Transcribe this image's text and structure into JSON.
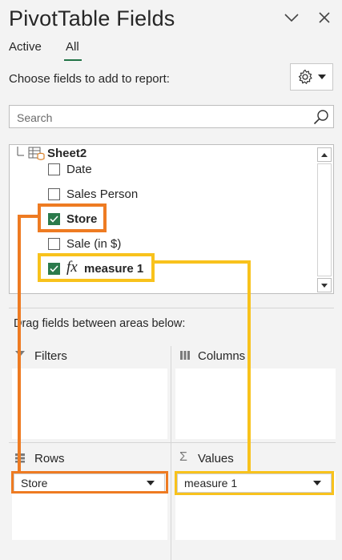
{
  "panel": {
    "title": "PivotTable Fields",
    "tabs": [
      {
        "label": "Active"
      },
      {
        "label": "All",
        "selected": true
      }
    ],
    "choose_label": "Choose fields to add to report:",
    "search": {
      "placeholder": "Search",
      "value": ""
    }
  },
  "field_list": {
    "table_name": "Sheet2",
    "fields": [
      {
        "label": "Date",
        "checked": false
      },
      {
        "label": "Sales Person",
        "checked": false
      },
      {
        "label": "Store",
        "checked": true,
        "bold": true
      },
      {
        "label": "Sale (in $)",
        "checked": false
      },
      {
        "label": "measure 1",
        "checked": true,
        "bold": true,
        "fx_glyph": "fx"
      }
    ]
  },
  "areas": {
    "drag_instruction": "Drag fields between areas below:",
    "filters": {
      "title": "Filters",
      "icon": "filter-icon",
      "items": []
    },
    "columns": {
      "title": "Columns",
      "icon": "columns-icon",
      "items": []
    },
    "rows": {
      "title": "Rows",
      "icon": "rows-icon",
      "items": [
        {
          "label": "Store"
        }
      ]
    },
    "values": {
      "title": "Values",
      "icon": "sigma-icon",
      "items": [
        {
          "label": "measure 1"
        }
      ]
    }
  },
  "highlight_colors": {
    "orange": "#ee7b22",
    "yellow": "#f8c21c",
    "checkbox": "#2b7a4b"
  }
}
